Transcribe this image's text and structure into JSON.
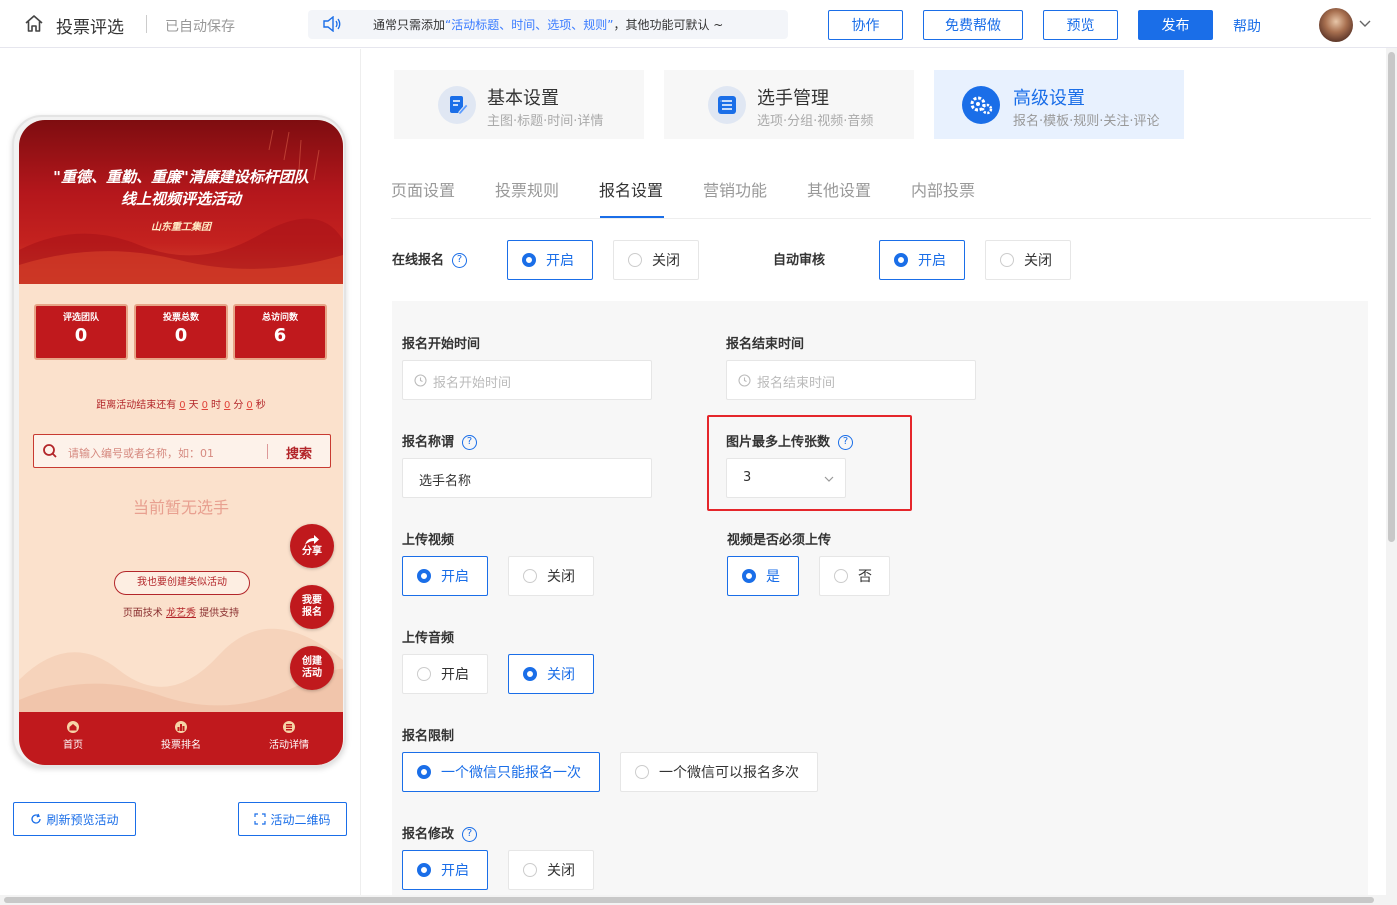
{
  "header": {
    "title": "投票评选",
    "saved_status": "已自动保存",
    "notice_prefix": "通常只需添加",
    "notice_highlight": "“活动标题、时间、选项、规则”",
    "notice_suffix": "，其他功能可默认 ~",
    "buttons": {
      "collab": "协作",
      "free_help": "免费帮做",
      "preview": "预览",
      "publish": "发布"
    },
    "help": "帮助",
    "accent_color": "#1a6ee8"
  },
  "preview": {
    "banner_line1": "\"重德、重勤、重廉\"清廉建设标杆团队",
    "banner_line2": "线上视频评选活动",
    "banner_org": "山东重工集团",
    "stats": [
      {
        "label": "评选团队",
        "value": "0"
      },
      {
        "label": "投票总数",
        "value": "0"
      },
      {
        "label": "总访问数",
        "value": "6"
      }
    ],
    "countdown": {
      "prefix": "距离活动结束还有",
      "days": "0",
      "d_unit": "天",
      "hours": "0",
      "h_unit": "时",
      "minutes": "0",
      "m_unit": "分",
      "seconds": "0",
      "s_unit": "秒"
    },
    "search_placeholder": "请输入编号或者名称，如：01",
    "search_button": "搜索",
    "empty_text": "当前暂无选手",
    "similar_button": "我也要创建类似活动",
    "support_prefix": "页面技术",
    "support_name": "龙艺秀",
    "support_suffix": "提供支持",
    "fab_share": "分享",
    "fab_signup_1": "我要",
    "fab_signup_2": "报名",
    "fab_create_1": "创建",
    "fab_create_2": "活动",
    "tabbar": [
      "首页",
      "投票排名",
      "活动详情"
    ],
    "theme_color": "#c0191d"
  },
  "left_buttons": {
    "refresh": "刷新预览活动",
    "qrcode": "活动二维码"
  },
  "cards": [
    {
      "title": "基本设置",
      "subtitle": "主图·标题·时间·详情"
    },
    {
      "title": "选手管理",
      "subtitle": "选项·分组·视频·音频"
    },
    {
      "title": "高级设置",
      "subtitle": "报名·模板·规则·关注·评论"
    }
  ],
  "tabs": [
    "页面设置",
    "投票规则",
    "报名设置",
    "营销功能",
    "其他设置",
    "内部投票"
  ],
  "form": {
    "online_signup": {
      "label": "在线报名",
      "on": "开启",
      "off": "关闭"
    },
    "auto_review": {
      "label": "自动审核",
      "on": "开启",
      "off": "关闭"
    },
    "start_time": {
      "label": "报名开始时间",
      "placeholder": "报名开始时间"
    },
    "end_time": {
      "label": "报名结束时间",
      "placeholder": "报名结束时间"
    },
    "title_name": {
      "label": "报名称谓",
      "value": "选手名称"
    },
    "max_images": {
      "label": "图片最多上传张数",
      "value": "3"
    },
    "upload_video": {
      "label": "上传视频",
      "on": "开启",
      "off": "关闭"
    },
    "video_required": {
      "label": "视频是否必须上传",
      "yes": "是",
      "no": "否"
    },
    "upload_audio": {
      "label": "上传音频",
      "on": "开启",
      "off": "关闭"
    },
    "limit": {
      "label": "报名限制",
      "once": "一个微信只能报名一次",
      "multi": "一个微信可以报名多次"
    },
    "modify": {
      "label": "报名修改",
      "on": "开启",
      "off": "关闭"
    }
  }
}
